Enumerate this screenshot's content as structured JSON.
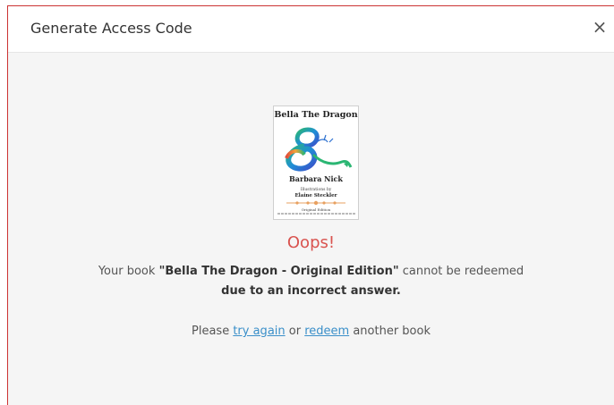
{
  "modal": {
    "title": "Generate Access Code",
    "close_label": "×"
  },
  "book": {
    "cover_title": "Bella The Dragon",
    "cover_author": "Barbara Nick",
    "cover_illustrations_label": "Illustrations by",
    "cover_illustrator": "Elaine Steckler",
    "cover_edition": "Original Edition"
  },
  "message": {
    "heading": "Oops!",
    "line1_prefix": "Your book ",
    "book_name": "\"Bella The Dragon - Original Edition\"",
    "line1_suffix": " cannot be redeemed",
    "line2": "due to an incorrect answer."
  },
  "actions": {
    "prefix": "Please ",
    "try_again": "try again",
    "middle": " or ",
    "redeem": "redeem",
    "suffix": " another book"
  },
  "colors": {
    "error": "#d9534f",
    "link": "#3a8fc9",
    "accent_border": "#cc3333"
  }
}
